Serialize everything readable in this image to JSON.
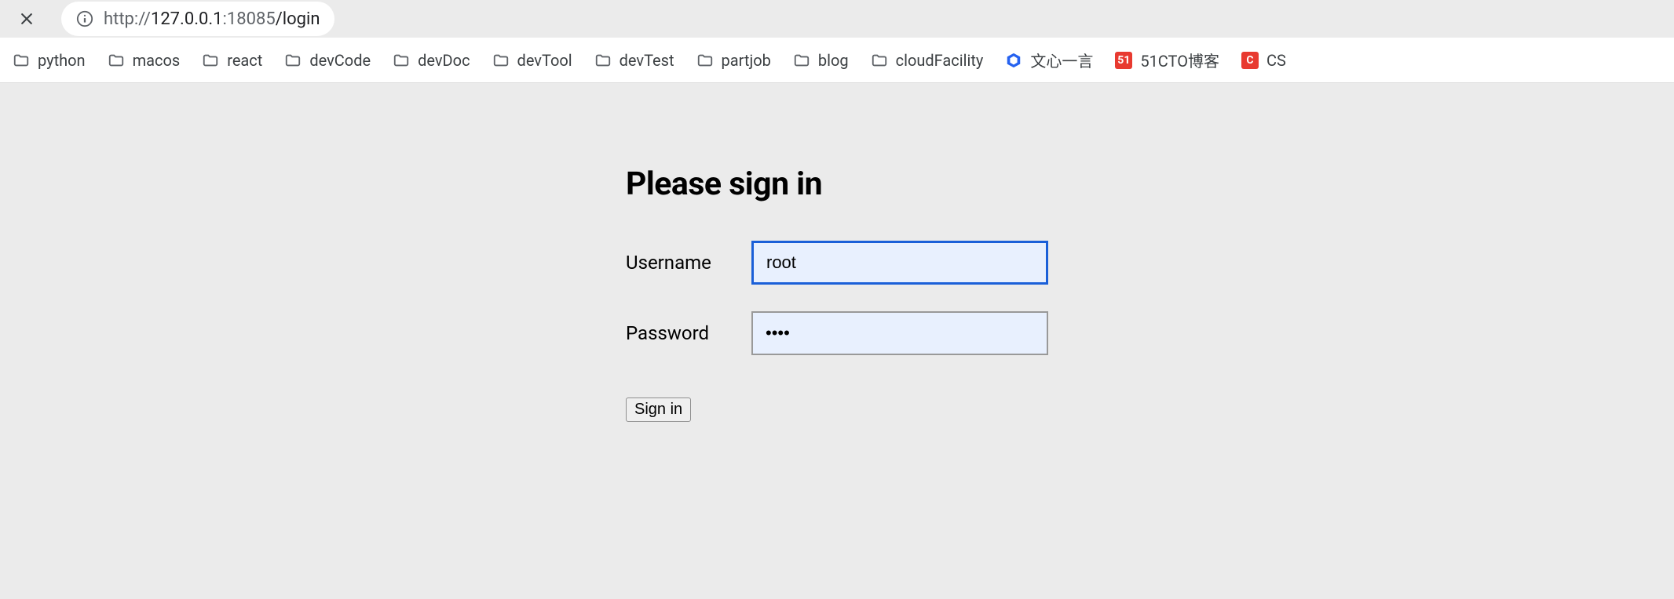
{
  "browser": {
    "url_protocol": "http://",
    "url_host": "127.0.0.1",
    "url_port": ":18085",
    "url_path": "/login"
  },
  "bookmarks": {
    "folders": [
      {
        "label": "python"
      },
      {
        "label": "macos"
      },
      {
        "label": "react"
      },
      {
        "label": "devCode"
      },
      {
        "label": "devDoc"
      },
      {
        "label": "devTool"
      },
      {
        "label": "devTest"
      },
      {
        "label": "partjob"
      },
      {
        "label": "blog"
      },
      {
        "label": "cloudFacility"
      }
    ],
    "sites": [
      {
        "label": "文心一言",
        "icon": "wenxin"
      },
      {
        "label": "51CTO博客",
        "icon": "cto51"
      },
      {
        "label": "CS",
        "icon": "cs"
      }
    ]
  },
  "login": {
    "title": "Please sign in",
    "username_label": "Username",
    "username_value": "root",
    "password_label": "Password",
    "password_value": "••••",
    "signin_button": "Sign in"
  }
}
